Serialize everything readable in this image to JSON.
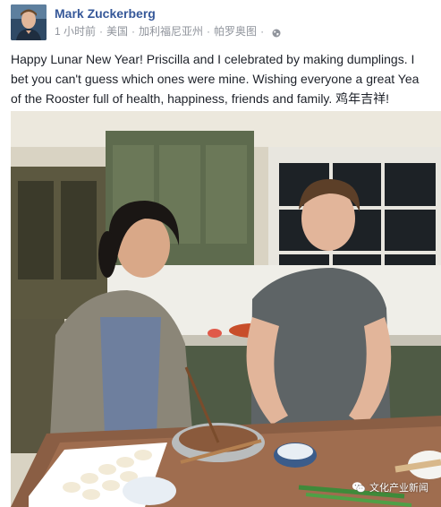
{
  "post": {
    "author_name": "Mark Zuckerberg",
    "time": "1 小时前",
    "location_country": "美国",
    "location_state": "加利福尼亚州",
    "location_city": "帕罗奥图",
    "separator": "·",
    "privacy_icon": "globe-icon",
    "text_lines": [
      "Happy Lunar New Year! Priscilla and I celebrated by making dumplings. I",
      "bet you can't guess which ones were mine. Wishing everyone a great Yea",
      "of the Rooster full of health, happiness, friends and family. 鸡年吉祥!"
    ]
  },
  "photo": {
    "watermark_text": "文化产业新闻",
    "watermark_icon": "wechat-icon"
  },
  "colors": {
    "author_link": "#365899",
    "meta_text": "#90949c",
    "body_text": "#1d2129"
  }
}
